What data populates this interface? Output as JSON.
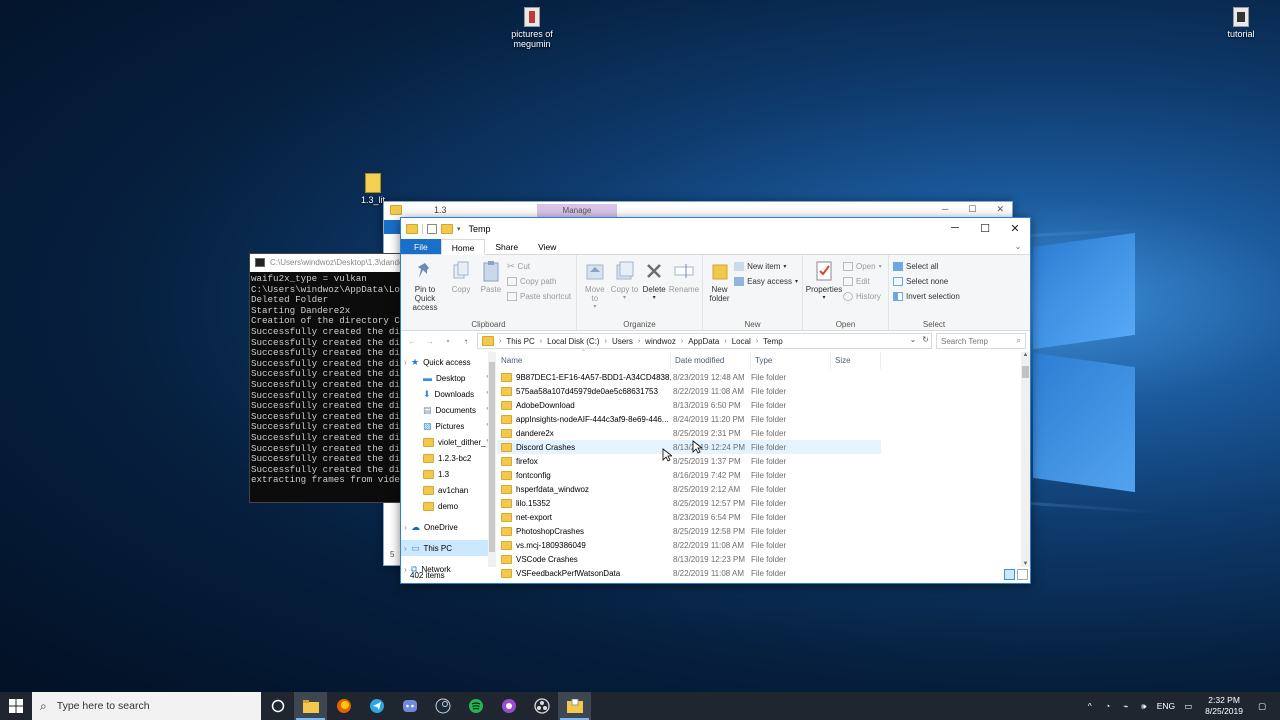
{
  "desktop": {
    "icons": [
      {
        "label": "pictures of megumin",
        "icon": "document-icon"
      },
      {
        "label": "tutorial",
        "icon": "document-icon"
      },
      {
        "label": "1.3_lit",
        "icon": "zip-folder-icon"
      }
    ]
  },
  "back_window": {
    "manage_tab": "Manage",
    "title": "1.3",
    "side_count": "5"
  },
  "console": {
    "title": "C:\\Users\\windwoz\\Desktop\\1.3\\dandere2x",
    "lines": [
      "waifu2x_type = vulkan",
      "C:\\Users\\windwoz\\AppData\\Loc",
      "Deleted Folder",
      "Starting Dandere2x",
      "Creation of the directory C:",
      "Successfully created the dir",
      "Successfully created the dir",
      "Successfully created the dir",
      "Successfully created the dir",
      "Successfully created the dir",
      "Successfully created the dir",
      "Successfully created the dir",
      "Successfully created the dir",
      "Successfully created the dir",
      "Successfully created the dir",
      "Successfully created the dir",
      "Successfully created the dir",
      "Successfully created the dir",
      "Successfully created the dir",
      "extracting frames from video"
    ]
  },
  "explorer": {
    "title": "Temp",
    "tabs": {
      "file": "File",
      "home": "Home",
      "share": "Share",
      "view": "View"
    },
    "ribbon": {
      "clipboard": {
        "label": "Clipboard",
        "pin": "Pin to Quick access",
        "copy": "Copy",
        "paste": "Paste",
        "cut": "Cut",
        "copy_path": "Copy path",
        "paste_shortcut": "Paste shortcut"
      },
      "organize": {
        "label": "Organize",
        "move_to": "Move to",
        "copy_to": "Copy to",
        "delete": "Delete",
        "rename": "Rename"
      },
      "new": {
        "label": "New",
        "new_folder": "New folder",
        "new_item": "New item",
        "easy_access": "Easy access"
      },
      "open": {
        "label": "Open",
        "properties": "Properties",
        "open": "Open",
        "edit": "Edit",
        "history": "History"
      },
      "select": {
        "label": "Select",
        "select_all": "Select all",
        "select_none": "Select none",
        "invert": "Invert selection"
      }
    },
    "breadcrumb": [
      "This PC",
      "Local Disk (C:)",
      "Users",
      "windwoz",
      "AppData",
      "Local",
      "Temp"
    ],
    "search_placeholder": "Search Temp",
    "nav": [
      {
        "label": "Quick access",
        "icon": "star-icon",
        "pinned": false,
        "level": 0
      },
      {
        "label": "Desktop",
        "icon": "desktop-icon",
        "pinned": true,
        "level": 1
      },
      {
        "label": "Downloads",
        "icon": "download-icon",
        "pinned": true,
        "level": 1
      },
      {
        "label": "Documents",
        "icon": "documents-icon",
        "pinned": true,
        "level": 1
      },
      {
        "label": "Pictures",
        "icon": "pictures-icon",
        "pinned": true,
        "level": 1
      },
      {
        "label": "violet_dither_",
        "icon": "folder-icon",
        "pinned": true,
        "level": 1
      },
      {
        "label": "1.2.3-bc2",
        "icon": "folder-icon",
        "pinned": false,
        "level": 1
      },
      {
        "label": "1.3",
        "icon": "folder-icon",
        "pinned": false,
        "level": 1
      },
      {
        "label": "av1chan",
        "icon": "folder-icon",
        "pinned": false,
        "level": 1
      },
      {
        "label": "demo",
        "icon": "folder-icon",
        "pinned": false,
        "level": 1
      },
      {
        "label": "",
        "icon": "",
        "pinned": false,
        "level": -1
      },
      {
        "label": "OneDrive",
        "icon": "cloud-icon",
        "pinned": false,
        "level": 0
      },
      {
        "label": "",
        "icon": "",
        "pinned": false,
        "level": -1
      },
      {
        "label": "This PC",
        "icon": "computer-icon",
        "pinned": false,
        "level": 0,
        "selected": true
      },
      {
        "label": "",
        "icon": "",
        "pinned": false,
        "level": -1
      },
      {
        "label": "Network",
        "icon": "network-icon",
        "pinned": false,
        "level": 0
      }
    ],
    "columns": {
      "name": "Name",
      "date": "Date modified",
      "type": "Type",
      "size": "Size"
    },
    "files": [
      {
        "name": "9B87DEC1-EF16-4A57-BDD1-A34CD4838...",
        "date": "8/23/2019 12:48 AM",
        "type": "File folder"
      },
      {
        "name": "575aa58a107d45979de0ae5c68631753",
        "date": "8/22/2019 11:08 AM",
        "type": "File folder"
      },
      {
        "name": "AdobeDownload",
        "date": "8/13/2019 6:50 PM",
        "type": "File folder"
      },
      {
        "name": "appInsights-nodeAIF-444c3af9-8e69-446...",
        "date": "8/24/2019 11:20 PM",
        "type": "File folder"
      },
      {
        "name": "dandere2x",
        "date": "8/25/2019 2:31 PM",
        "type": "File folder"
      },
      {
        "name": "Discord Crashes",
        "date": "8/13/2019 12:24 PM",
        "type": "File folder"
      },
      {
        "name": "firefox",
        "date": "8/25/2019 1:37 PM",
        "type": "File folder"
      },
      {
        "name": "fontconfig",
        "date": "8/16/2019 7:42 PM",
        "type": "File folder"
      },
      {
        "name": "hsperfdata_windwoz",
        "date": "8/25/2019 2:12 AM",
        "type": "File folder"
      },
      {
        "name": "lilo.15352",
        "date": "8/25/2019 12:57 PM",
        "type": "File folder"
      },
      {
        "name": "net-export",
        "date": "8/23/2019 6:54 PM",
        "type": "File folder"
      },
      {
        "name": "PhotoshopCrashes",
        "date": "8/25/2019 12:58 PM",
        "type": "File folder"
      },
      {
        "name": "vs.mcj-1809386049",
        "date": "8/22/2019 11:08 AM",
        "type": "File folder"
      },
      {
        "name": "VSCode Crashes",
        "date": "8/13/2019 12:23 PM",
        "type": "File folder"
      },
      {
        "name": "VSFeedbackPerfWatsonData",
        "date": "8/22/2019 11:08 AM",
        "type": "File folder"
      }
    ],
    "status": "402 items"
  },
  "taskbar": {
    "search_placeholder": "Type here to search",
    "apps": [
      "cortana-icon",
      "file-explorer-icon",
      "firefox-icon",
      "telegram-icon",
      "discord-icon",
      "steam-icon",
      "spotify-icon",
      "purple-app-icon",
      "obs-icon",
      "file-manager-icon"
    ],
    "lang": "ENG",
    "time": "2:32 PM",
    "date": "8/25/2019"
  },
  "colors": {
    "accent": "#1a6fc6",
    "folder": "#f2c94c",
    "taskbar": "#1f2630",
    "selection": "#cce8ff"
  }
}
